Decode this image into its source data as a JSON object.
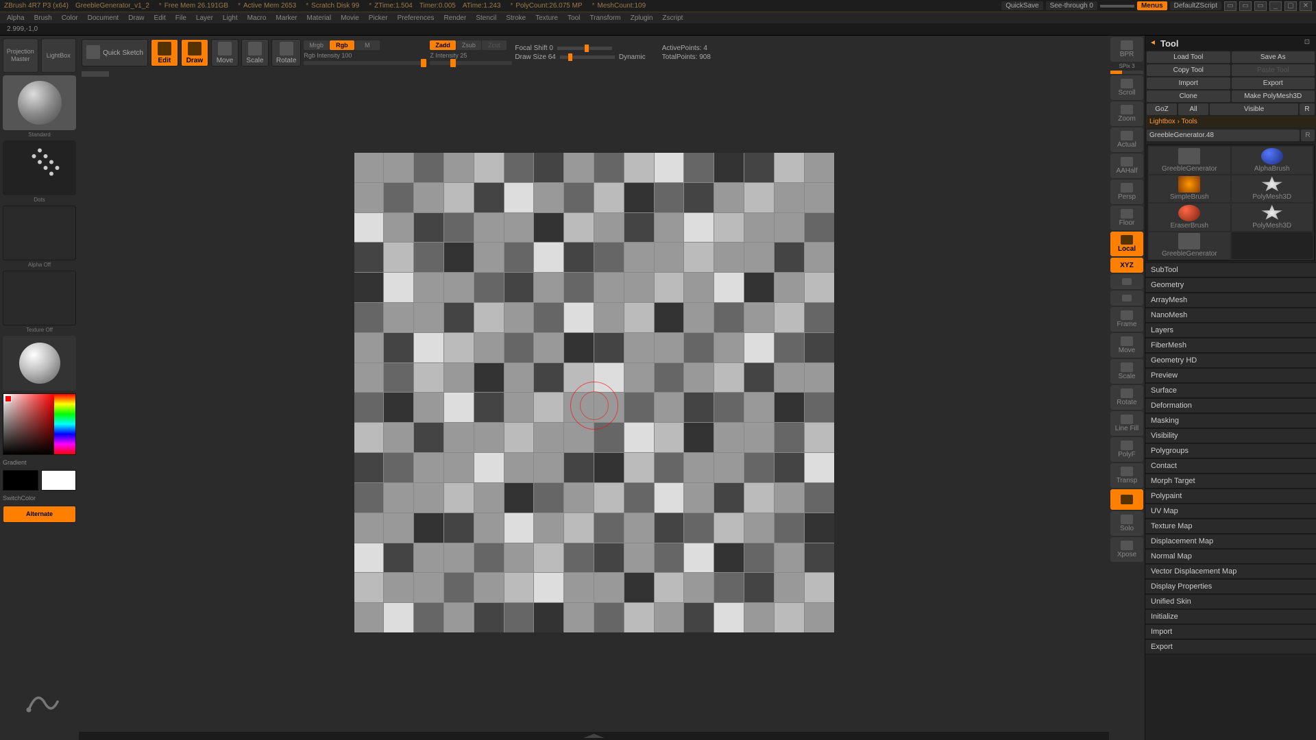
{
  "titlebar": {
    "app": "ZBrush 4R7 P3 (x64)",
    "filename": "GreebleGenerator_v1_2",
    "freemem": "Free Mem 26.191GB",
    "activemem": "Active Mem 2653",
    "scratch": "Scratch Disk 99",
    "ztime": "ZTime:1.504",
    "timer": "Timer:0.005",
    "atime": "ATime:1.243",
    "polycount": "PolyCount:26.075 MP",
    "meshcount": "MeshCount:109",
    "quicksave": "QuickSave",
    "seethrough": "See-through  0",
    "menus": "Menus",
    "defaultscript": "DefaultZScript"
  },
  "menubar": [
    "Alpha",
    "Brush",
    "Color",
    "Document",
    "Draw",
    "Edit",
    "File",
    "Layer",
    "Light",
    "Macro",
    "Marker",
    "Material",
    "Movie",
    "Picker",
    "Preferences",
    "Render",
    "Stencil",
    "Stroke",
    "Texture",
    "Tool",
    "Transform",
    "Zplugin",
    "Zscript"
  ],
  "status": "2.999,-1,0",
  "left": {
    "projection_master": "Projection\nMaster",
    "lightbox": "LightBox",
    "standard": "Standard",
    "dots": "Dots",
    "alpha_off": "Alpha Off",
    "texture_off": "Texture Off",
    "gradient": "Gradient",
    "switchcolor": "SwitchColor",
    "alternate": "Alternate"
  },
  "toolbar": {
    "quicksketch": "Quick\nSketch",
    "edit": "Edit",
    "draw": "Draw",
    "move": "Move",
    "scale": "Scale",
    "rotate": "Rotate",
    "mrgb": "Mrgb",
    "rgb": "Rgb",
    "m": "M",
    "rgb_intensity": "Rgb Intensity 100",
    "zadd": "Zadd",
    "zsub": "Zsub",
    "zcut": "Zcut",
    "z_intensity": "Z Intensity 25",
    "focal_shift": "Focal Shift 0",
    "draw_size": "Draw Size 64",
    "dynamic": "Dynamic",
    "active": "ActivePoints: 4",
    "total": "TotalPoints: 908"
  },
  "rightnav": {
    "spix": "SPix 3",
    "items": [
      "BPR",
      "Scroll",
      "Zoom",
      "Actual",
      "AAHalf",
      "Persp",
      "Floor",
      "Local",
      "XYZ",
      "",
      "",
      "Frame",
      "Move",
      "Scale",
      "Rotate",
      "Line Fill",
      "PolyF",
      "Transp",
      "",
      "Solo",
      "Xpose"
    ]
  },
  "toolpanel": {
    "title": "Tool",
    "load": "Load Tool",
    "save": "Save As",
    "copy": "Copy Tool",
    "paste": "Paste Tool",
    "import": "Import",
    "export": "Export",
    "clone": "Clone",
    "makepolymesh": "Make PolyMesh3D",
    "goz": "GoZ",
    "all": "All",
    "visible": "Visible",
    "r": "R",
    "lightboxtools": "Lightbox › Tools",
    "current": "GreebleGenerator.48",
    "gallery": [
      "GreebleGenerator",
      "AlphaBrush",
      "",
      "SimpleBrush",
      "EraserBrush",
      "PolyMesh3D",
      "GreebleGenerator",
      ""
    ]
  },
  "sections": [
    "SubTool",
    "Geometry",
    "ArrayMesh",
    "NanoMesh",
    "Layers",
    "FiberMesh",
    "Geometry HD",
    "Preview",
    "Surface",
    "Deformation",
    "Masking",
    "Visibility",
    "Polygroups",
    "Contact",
    "Morph Target",
    "Polypaint",
    "UV Map",
    "Texture Map",
    "Displacement Map",
    "Normal Map",
    "Vector Displacement Map",
    "Display Properties",
    "Unified Skin",
    "Initialize",
    "Import",
    "Export"
  ]
}
